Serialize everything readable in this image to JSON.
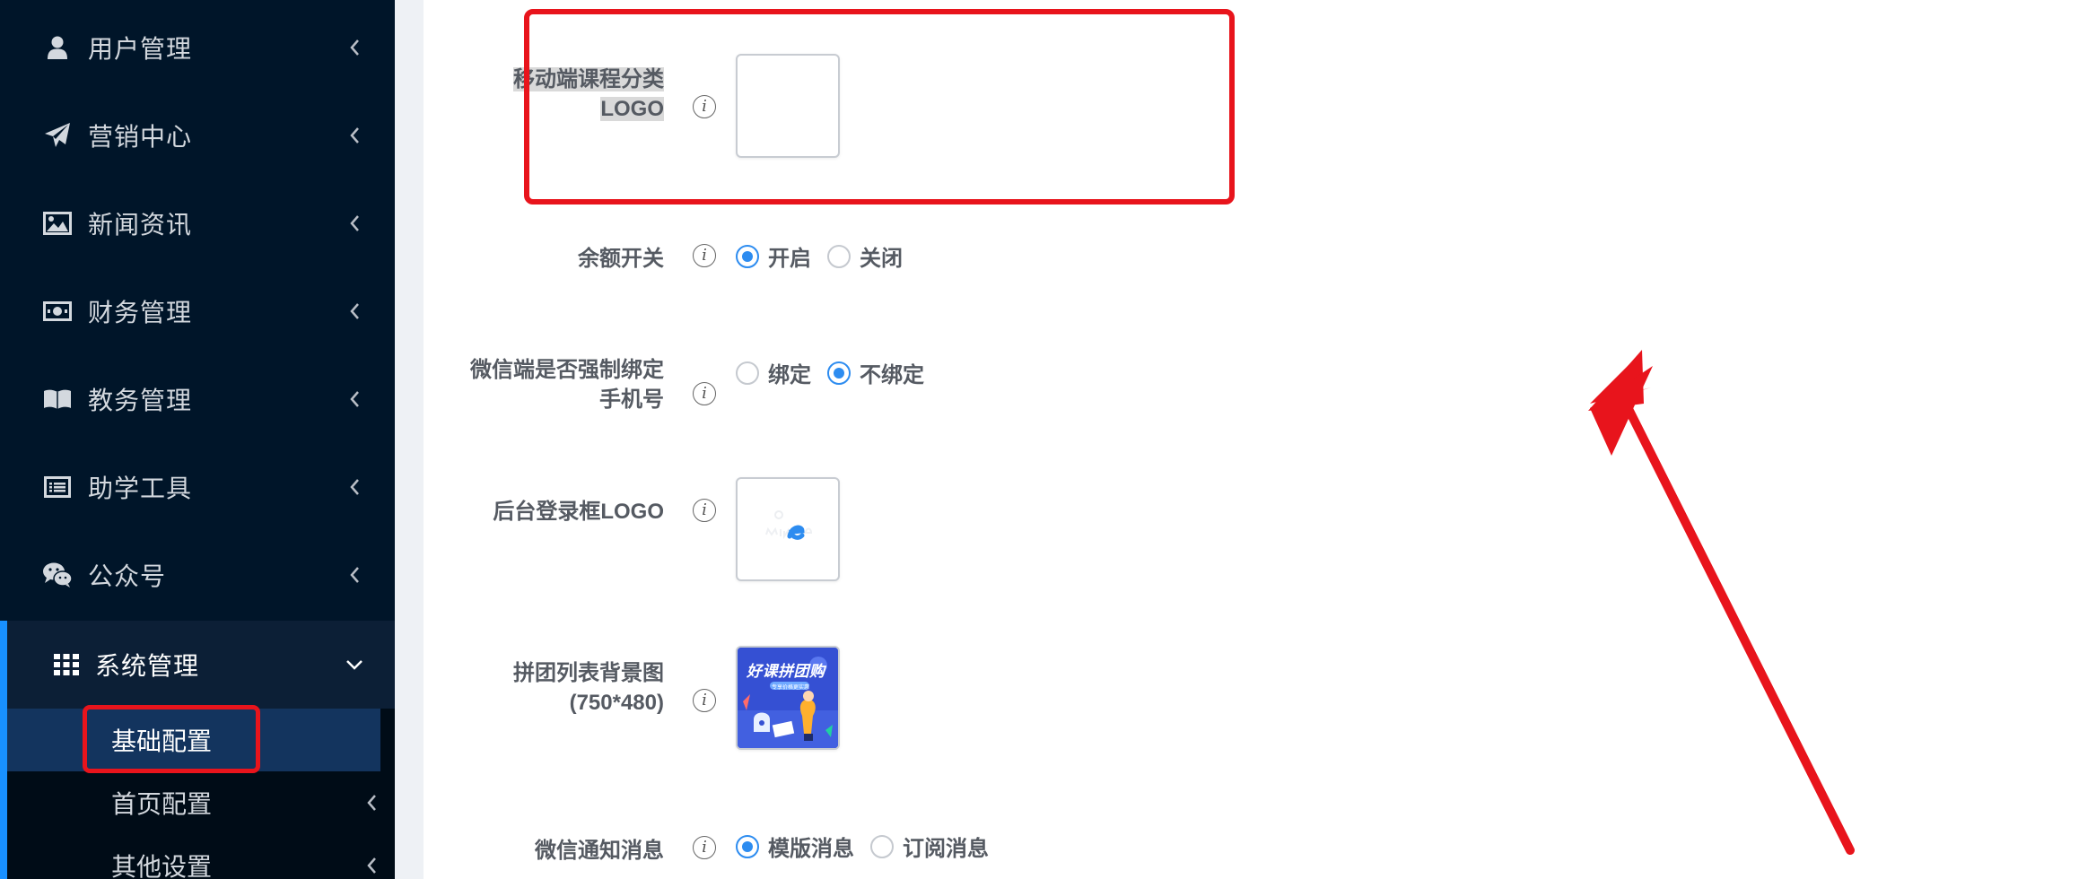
{
  "sidebar": {
    "items": [
      {
        "label": "用户管理",
        "icon": "user-icon"
      },
      {
        "label": "营销中心",
        "icon": "paper-plane-icon"
      },
      {
        "label": "新闻资讯",
        "icon": "image-icon"
      },
      {
        "label": "财务管理",
        "icon": "money-icon"
      },
      {
        "label": "教务管理",
        "icon": "book-icon"
      },
      {
        "label": "助学工具",
        "icon": "list-icon"
      },
      {
        "label": "公众号",
        "icon": "wechat-icon"
      }
    ],
    "open_item": {
      "label": "系统管理",
      "icon": "grid-icon"
    },
    "sub_items": [
      {
        "label": "基础配置",
        "active": true
      },
      {
        "label": "首页配置"
      },
      {
        "label": "其他设置"
      }
    ]
  },
  "form": {
    "mobile_logo": {
      "label_line1": "移动端课程分类",
      "label_line2": "LOGO"
    },
    "balance_switch": {
      "label": "余额开关",
      "options": [
        "开启",
        "关闭"
      ],
      "selected": "开启"
    },
    "wechat_bind": {
      "label_line1": "微信端是否强制绑定",
      "label_line2": "手机号",
      "options": [
        "绑定",
        "不绑定"
      ],
      "selected": "不绑定"
    },
    "admin_login_logo": {
      "label": "后台登录框LOGO"
    },
    "group_bg": {
      "label_line1": "拼团列表背景图",
      "label_line2": "(750*480)",
      "banner_text": "好课拼团购",
      "banner_sub": "专享价格更实惠"
    },
    "wechat_notice": {
      "label": "微信通知消息",
      "options": [
        "模版消息",
        "订阅消息"
      ],
      "selected": "模版消息"
    }
  },
  "colors": {
    "sidebar_bg": "#001529",
    "accent": "#1890ff",
    "radio": "#2d8cf0",
    "annotation": "#e8141c"
  }
}
